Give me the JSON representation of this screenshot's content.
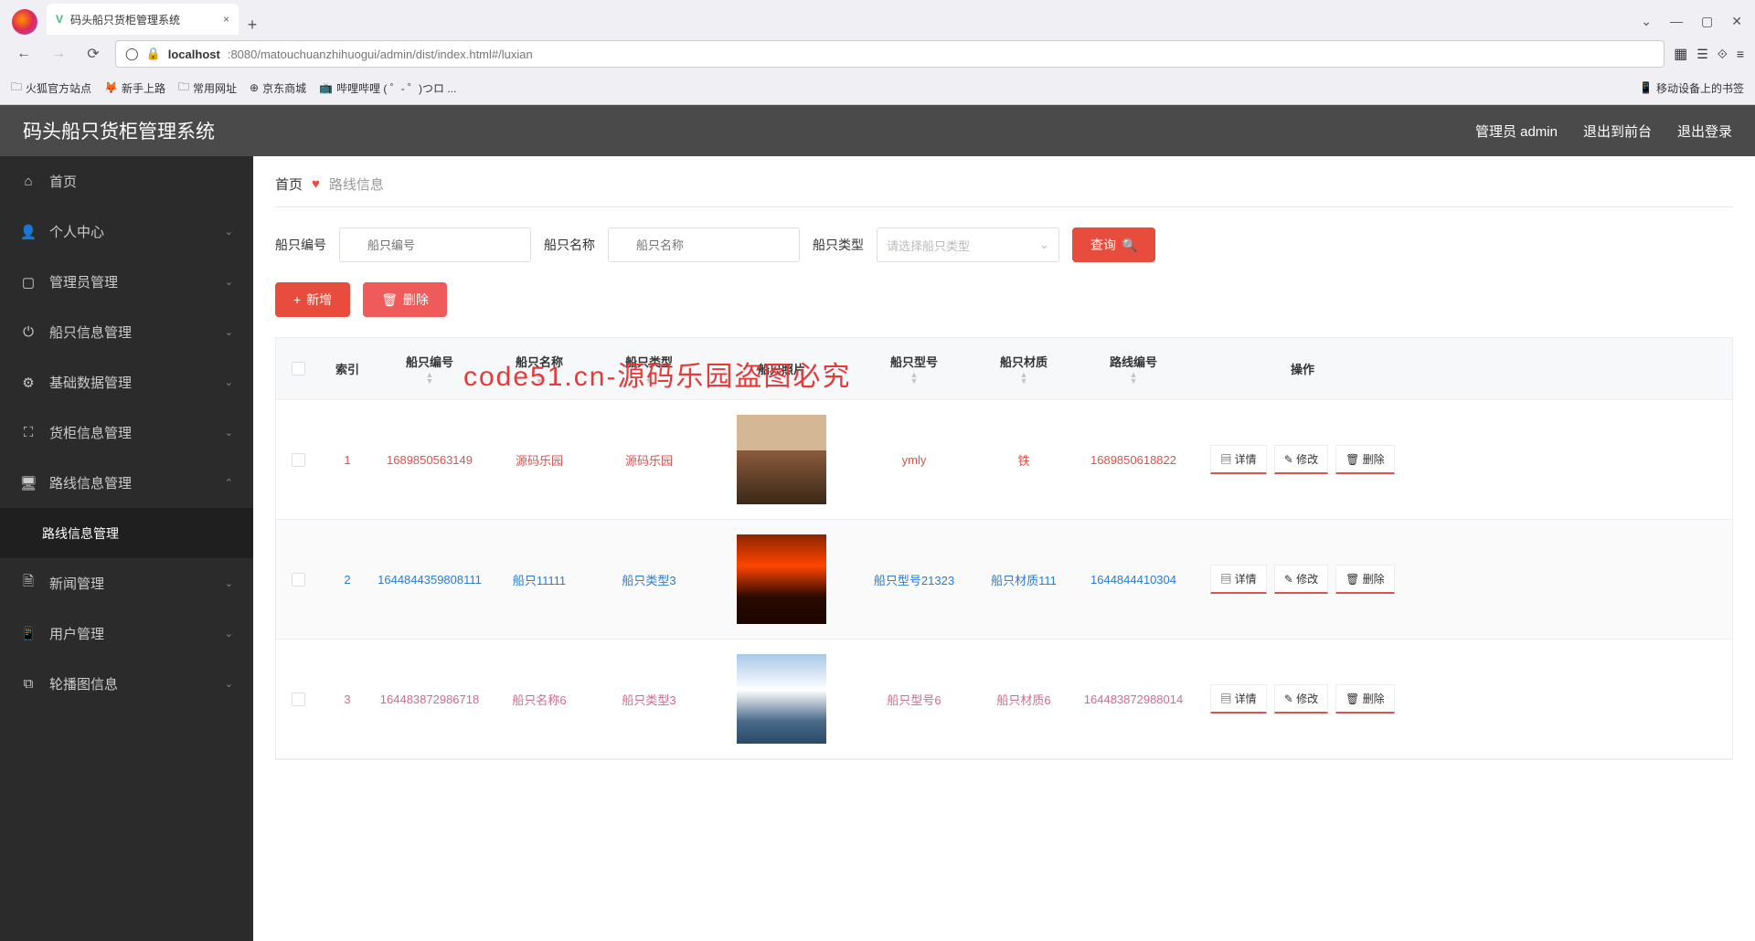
{
  "browser": {
    "tab_title": "码头船只货柜管理系统",
    "url_host": "localhost",
    "url_path": ":8080/matouchuanzhihuogui/admin/dist/index.html#/luxian",
    "bookmarks": [
      "火狐官方站点",
      "新手上路",
      "常用网址",
      "京东商城",
      "哔哩哔哩 ( ゜- ゜)つロ ..."
    ],
    "mobile_bm": "移动设备上的书签"
  },
  "header": {
    "title": "码头船只货柜管理系统",
    "admin": "管理员 admin",
    "exit_front": "退出到前台",
    "logout": "退出登录"
  },
  "sidebar": {
    "items": [
      {
        "icon": "home",
        "label": "首页"
      },
      {
        "icon": "user",
        "label": "个人中心",
        "arrow": true
      },
      {
        "icon": "crop",
        "label": "管理员管理",
        "arrow": true
      },
      {
        "icon": "power",
        "label": "船只信息管理",
        "arrow": true
      },
      {
        "icon": "gear",
        "label": "基础数据管理",
        "arrow": true
      },
      {
        "icon": "expand",
        "label": "货柜信息管理",
        "arrow": true
      },
      {
        "icon": "monitor",
        "label": "路线信息管理",
        "arrow": true,
        "open": true,
        "sub": "路线信息管理"
      },
      {
        "icon": "doc",
        "label": "新闻管理",
        "arrow": true
      },
      {
        "icon": "device",
        "label": "用户管理",
        "arrow": true
      },
      {
        "icon": "copy",
        "label": "轮播图信息",
        "arrow": true
      }
    ]
  },
  "breadcrumb": {
    "home": "首页",
    "current": "路线信息"
  },
  "search": {
    "label1": "船只编号",
    "ph1": "船只编号",
    "label2": "船只名称",
    "ph2": "船只名称",
    "label3": "船只类型",
    "ph3": "请选择船只类型",
    "query": "查询"
  },
  "actions": {
    "add": "新增",
    "del": "删除"
  },
  "table": {
    "headers": [
      "索引",
      "船只编号",
      "船只名称",
      "船只类型",
      "船只照片",
      "船只型号",
      "船只材质",
      "路线编号",
      "操作"
    ],
    "ops": {
      "detail": "详情",
      "edit": "修改",
      "del": "删除"
    },
    "rows": [
      {
        "idx": "1",
        "no": "1689850563149",
        "name": "源码乐园",
        "type": "源码乐园",
        "img": "ship1",
        "model": "ymly",
        "mat": "铁",
        "route": "1689850618822",
        "cls": "link-red"
      },
      {
        "idx": "2",
        "no": "1644844359808111",
        "name": "船只11111",
        "type": "船只类型3",
        "img": "ship2",
        "model": "船只型号21323",
        "mat": "船只材质111",
        "route": "1644844410304",
        "cls": "link-blue"
      },
      {
        "idx": "3",
        "no": "164483872986718",
        "name": "船只名称6",
        "type": "船只类型3",
        "img": "ship3",
        "model": "船只型号6",
        "mat": "船只材质6",
        "route": "164483872988014",
        "cls": "link-pink"
      }
    ]
  },
  "watermark_red": "code51.cn-源码乐园盗图必究"
}
